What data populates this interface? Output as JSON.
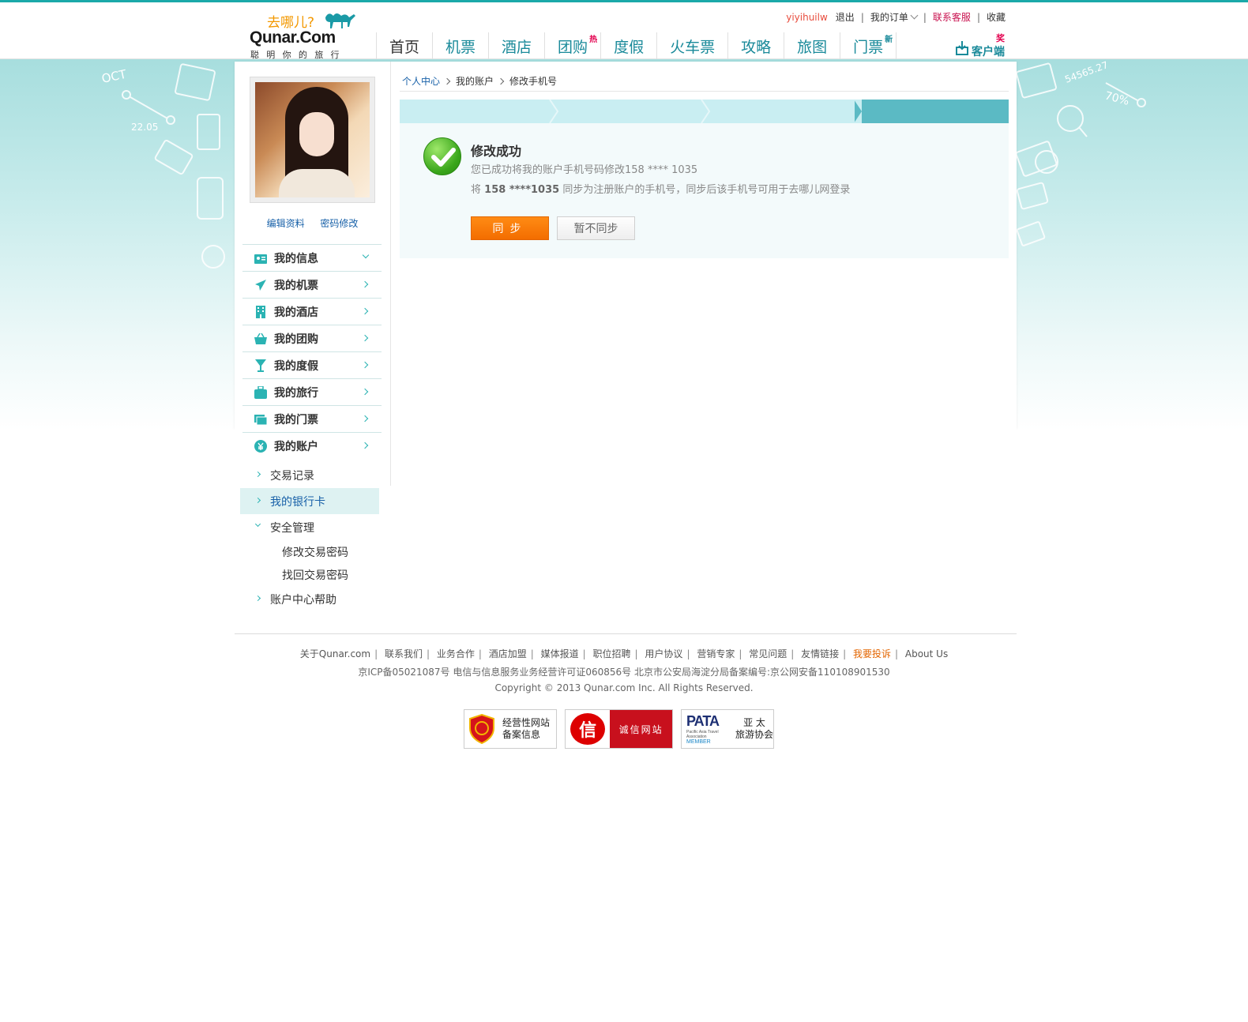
{
  "header": {
    "logo": {
      "cn": "去哪儿?",
      "en": "Qunar.Com",
      "slogan": "聪明你的旅行"
    },
    "toplinks": {
      "username": "yiyihuilw",
      "logout": "退出",
      "my_orders": "我的订单",
      "customer_service": "联系客服",
      "favorite": "收藏"
    },
    "nav": [
      {
        "label": "首页",
        "badge": ""
      },
      {
        "label": "机票",
        "badge": ""
      },
      {
        "label": "酒店",
        "badge": ""
      },
      {
        "label": "团购",
        "badge": "热"
      },
      {
        "label": "度假",
        "badge": ""
      },
      {
        "label": "火车票",
        "badge": ""
      },
      {
        "label": "攻略",
        "badge": ""
      },
      {
        "label": "旅图",
        "badge": ""
      },
      {
        "label": "门票",
        "badge": "新"
      }
    ],
    "client": {
      "award": "奖",
      "label": "客户端"
    }
  },
  "profile": {
    "edit_profile": "编辑资料",
    "change_password": "密码修改"
  },
  "side_menu": [
    {
      "label": "我的信息",
      "icon": "id-card-icon",
      "expanded": true
    },
    {
      "label": "我的机票",
      "icon": "plane-icon"
    },
    {
      "label": "我的酒店",
      "icon": "building-icon"
    },
    {
      "label": "我的团购",
      "icon": "basket-icon"
    },
    {
      "label": "我的度假",
      "icon": "cocktail-icon"
    },
    {
      "label": "我的旅行",
      "icon": "luggage-icon"
    },
    {
      "label": "我的门票",
      "icon": "ticket-icon"
    },
    {
      "label": "我的账户",
      "icon": "yuan-icon"
    }
  ],
  "sub_menu": {
    "transactions": "交易记录",
    "bank_cards": "我的银行卡",
    "security": "安全管理",
    "change_trade_pwd": "修改交易密码",
    "recover_trade_pwd": "找回交易密码",
    "help": "账户中心帮助"
  },
  "breadcrumb": [
    "个人中心",
    "我的账户",
    "修改手机号"
  ],
  "result": {
    "title": "修改成功",
    "line1": "您已成功将我的账户手机号码修改158 **** 1035",
    "line2_prefix": "将",
    "line2_number": "158 ****1035",
    "line2_suffix": "同步为注册账户的手机号，同步后该手机号可用于去哪儿网登录",
    "sync_button": "同步",
    "skip_button": "暂不同步"
  },
  "footer": {
    "links": [
      "关于Qunar.com",
      "联系我们",
      "业务合作",
      "酒店加盟",
      "媒体报道",
      "职位招聘",
      "用户协议",
      "营销专家",
      "常见问题",
      "友情链接",
      "我要投诉",
      "About Us"
    ],
    "icp": "京ICP备05021087号   电信与信息服务业务经营许可证060856号   北京市公安局海淀分局备案编号:京公网安备110108901530",
    "copyright": "Copyright © 2013 Qunar.com Inc. All Rights Reserved.",
    "badge1": {
      "line1": "经营性网站",
      "line2": "备案信息"
    },
    "badge2": {
      "left": "信",
      "right": "诚信网站"
    },
    "badge3": {
      "word": "PATA",
      "sub": "Pacific Asia Travel Association",
      "member": "MEMBER",
      "line1": "亚 太",
      "line2": "旅游协会"
    }
  },
  "background_deco": {
    "oct": "OCT",
    "date": "22.05",
    "num": "54565.27",
    "pct": "70%"
  }
}
